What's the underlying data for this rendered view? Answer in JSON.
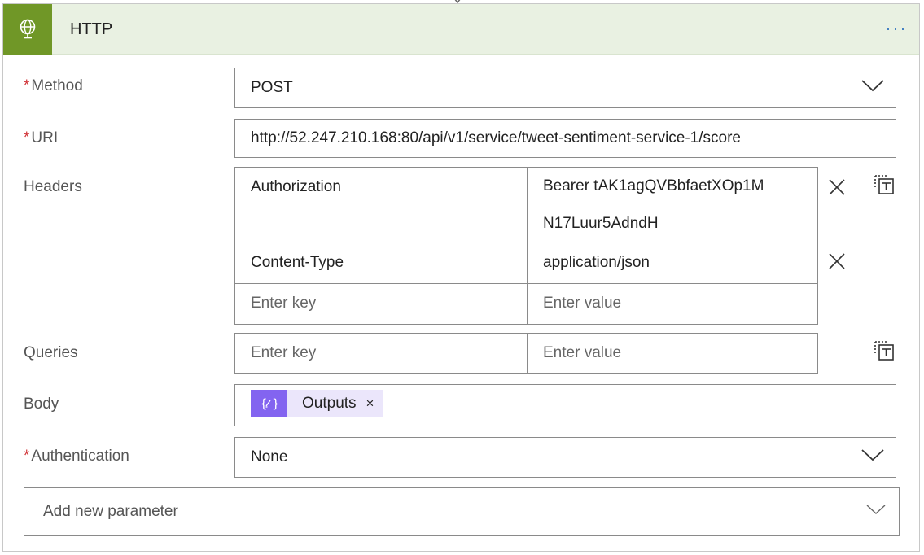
{
  "header": {
    "title": "HTTP",
    "more_label": "···",
    "accent_color": "#709727",
    "background_color": "#e9f1e2"
  },
  "method": {
    "label": "Method",
    "required_mark": "*",
    "value": "POST"
  },
  "uri": {
    "label": "URI",
    "required_mark": "*",
    "value": "http://52.247.210.168:80/api/v1/service/tweet-sentiment-service-1/score"
  },
  "headers": {
    "label": "Headers",
    "rows": [
      {
        "key": "Authorization",
        "value_line1": "Bearer tAK1agQVBbfaetXOp1M",
        "value_line2": "N17Luur5AdndH"
      },
      {
        "key": "Content-Type",
        "value": "application/json"
      }
    ],
    "key_placeholder": "Enter key",
    "value_placeholder": "Enter value"
  },
  "queries": {
    "label": "Queries",
    "key_placeholder": "Enter key",
    "value_placeholder": "Enter value"
  },
  "body": {
    "label": "Body",
    "token_label": "Outputs",
    "token_remove": "×",
    "token_color": "#8364f0"
  },
  "authentication": {
    "label": "Authentication",
    "required_mark": "*",
    "value": "None"
  },
  "add_parameter": {
    "label": "Add new parameter"
  },
  "icons": {
    "header": "globe-icon",
    "chevron": "chevron-down-icon",
    "remove": "close-icon",
    "text_mode": "text-mode-icon",
    "token": "expression-icon"
  }
}
